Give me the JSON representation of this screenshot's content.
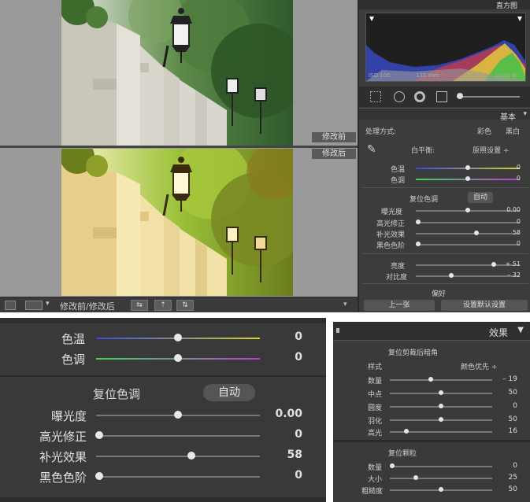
{
  "viewer": {
    "before_label": "修改前",
    "after_label": "修改后",
    "toolbar_label": "修改前/修改后"
  },
  "histogram": {
    "title": "直方图",
    "iso": "ISO 100",
    "focal": "135 mm",
    "aperture": "–",
    "shutter": "1/200 秒"
  },
  "basic": {
    "title": "基本",
    "treatment_label": "处理方式:",
    "treatment_color": "彩色",
    "treatment_bw": "黑白",
    "wb_label": "白平衡:",
    "wb_value": "原照设置 ÷",
    "temp_label": "色温",
    "temp_value": "0",
    "tint_label": "色调",
    "tint_value": "0",
    "tone_label": "复位色调",
    "auto_label": "自动",
    "exposure_label": "曝光度",
    "exposure_value": "0.00",
    "highlight_label": "高光修正",
    "highlight_value": "0",
    "fill_label": "补光效果",
    "fill_value": "58",
    "black_label": "黑色色阶",
    "black_value": "0",
    "brightness_label": "亮度",
    "brightness_value": "+ 51",
    "contrast_label": "对比度",
    "contrast_value": "– 32",
    "presence_label": "偏好",
    "prev_button": "上一张",
    "reset_button": "设置默认设置"
  },
  "zoom": {
    "temp_label": "色温",
    "temp_value": "0",
    "tint_label": "色调",
    "tint_value": "0",
    "tone_label": "复位色调",
    "auto_label": "自动",
    "exposure_label": "曝光度",
    "exposure_value": "0.00",
    "highlight_label": "高光修正",
    "highlight_value": "0",
    "fill_label": "补光效果",
    "fill_value": "58",
    "black_label": "黑色色阶",
    "black_value": "0",
    "slider_positions": {
      "temp": 0.5,
      "tint": 0.5,
      "exposure": 0.5,
      "highlight": 0.0,
      "fill": 0.58,
      "black": 0.0
    }
  },
  "effects": {
    "title": "效果",
    "vignette_title": "复位剪裁后暗角",
    "style_label": "样式",
    "style_value": "颜色优先 ÷",
    "amount_label": "数量",
    "amount_value": "– 19",
    "midpoint_label": "中点",
    "midpoint_value": "50",
    "roundness_label": "圆度",
    "roundness_value": "0",
    "feather_label": "羽化",
    "feather_value": "50",
    "highlights_label": "高光",
    "highlights_value": "16",
    "grain_title": "复位颗粒",
    "grain_amount_label": "数量",
    "grain_amount_value": "0",
    "grain_size_label": "大小",
    "grain_size_value": "25",
    "grain_rough_label": "粗糙度",
    "grain_rough_value": "50"
  },
  "colors": {
    "panel_bg": "#3a3a3a",
    "temp_track_start": "#3a4bd6",
    "temp_track_end": "#d6d23a",
    "tint_track_start": "#3ad65a",
    "tint_track_end": "#c23ad6"
  }
}
